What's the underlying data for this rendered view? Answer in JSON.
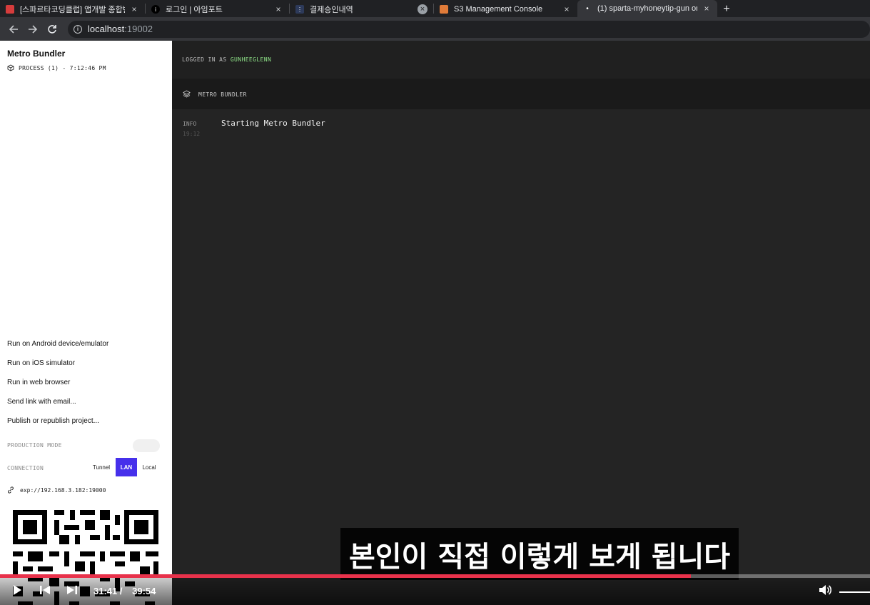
{
  "browser": {
    "tabs": [
      {
        "title": "[스파르타코딩클럽] 앱개발 종합반 -",
        "favicon": "book-icon",
        "color": "#d63c3c",
        "active": false
      },
      {
        "title": "로그인 | 아임포트",
        "favicon": "iamport-icon",
        "color": "#000000",
        "active": false
      },
      {
        "title": "결제승인내역",
        "favicon": "page-icon",
        "color": "#2d3a5a",
        "active": false
      },
      {
        "title": "S3 Management Console",
        "favicon": "aws-cube-icon",
        "color": "#e07b39",
        "active": false
      },
      {
        "title": "(1) sparta-myhoneytip-gun on",
        "favicon": "expo-icon",
        "color": "#ffffff",
        "active": true
      }
    ],
    "close_glyph": "×",
    "new_tab_glyph": "+",
    "url_host": "localhost",
    "url_port": ":19002"
  },
  "sidebar": {
    "title": "Metro Bundler",
    "process": "PROCESS (1) - 7:12:46 PM",
    "menu": [
      {
        "label": "Run on Android device/emulator"
      },
      {
        "label": "Run on iOS simulator"
      },
      {
        "label": "Run in web browser"
      },
      {
        "label": "Send link with email..."
      },
      {
        "label": "Publish or republish project..."
      }
    ],
    "publish_arrow": "↗",
    "production_mode_label": "PRODUCTION MODE",
    "production_mode_on": false,
    "connection_label": "CONNECTION",
    "connection_options": {
      "tunnel": "Tunnel",
      "lan": "LAN",
      "local": "Local"
    },
    "connection_selected": "LAN",
    "accent": "#4630eb",
    "exp_url": "exp://192.168.3.182:19000"
  },
  "main": {
    "logged_in_prefix": "LOGGED IN AS ",
    "username": "GUNHEEGLENN",
    "panel_title": "METRO BUNDLER",
    "log": {
      "level": "INFO",
      "time": "19:12",
      "message": "Starting Metro Bundler"
    }
  },
  "video": {
    "subtitle": "본인이 직접 이렇게 보게 됩니다",
    "current_time": "31:41",
    "separator": "/",
    "duration": "39:54",
    "progress_fraction": 0.794,
    "progress_color": "#e8324b"
  }
}
